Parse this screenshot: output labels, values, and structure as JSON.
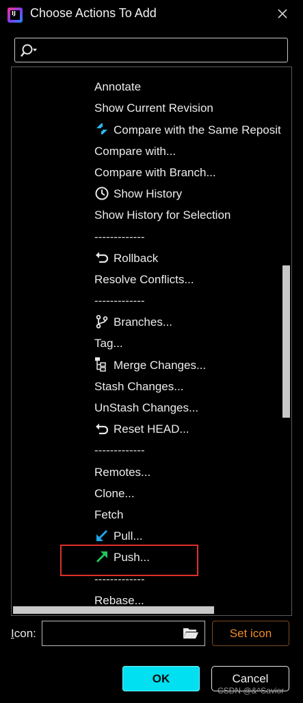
{
  "window": {
    "title": "Choose Actions To Add",
    "logo_text": "IJ"
  },
  "search": {
    "value": "",
    "placeholder": ""
  },
  "tree": {
    "items": [
      {
        "label": "-------------",
        "icon": null,
        "separator": true
      },
      {
        "label": "Annotate",
        "icon": null
      },
      {
        "label": "Show Current Revision",
        "icon": null
      },
      {
        "label": "Compare with the Same Reposit",
        "icon": "compare-icon"
      },
      {
        "label": "Compare with...",
        "icon": null
      },
      {
        "label": "Compare with Branch...",
        "icon": null
      },
      {
        "label": "Show History",
        "icon": "clock-icon"
      },
      {
        "label": "Show History for Selection",
        "icon": null
      },
      {
        "label": "-------------",
        "icon": null,
        "separator": true
      },
      {
        "label": "Rollback",
        "icon": "undo-icon"
      },
      {
        "label": "Resolve Conflicts...",
        "icon": null
      },
      {
        "label": "-------------",
        "icon": null,
        "separator": true
      },
      {
        "label": "Branches...",
        "icon": "branch-icon"
      },
      {
        "label": "Tag...",
        "icon": null
      },
      {
        "label": "Merge Changes...",
        "icon": "merge-icon"
      },
      {
        "label": "Stash Changes...",
        "icon": null
      },
      {
        "label": "UnStash Changes...",
        "icon": null
      },
      {
        "label": "Reset HEAD...",
        "icon": "undo-icon"
      },
      {
        "label": "-------------",
        "icon": null,
        "separator": true
      },
      {
        "label": "Remotes...",
        "icon": null
      },
      {
        "label": "Clone...",
        "icon": null
      },
      {
        "label": "Fetch",
        "icon": null
      },
      {
        "label": "Pull...",
        "icon": "pull-arrow-icon"
      },
      {
        "label": "Push...",
        "icon": "push-arrow-icon"
      },
      {
        "label": "-------------",
        "icon": null,
        "separator": true
      },
      {
        "label": "Rebase...",
        "icon": null
      }
    ]
  },
  "icon_row": {
    "label": "Icon:",
    "label_mnemonic": "I",
    "label_rest": "con:",
    "field_value": ""
  },
  "buttons": {
    "set_icon": "Set icon",
    "ok": "OK",
    "cancel": "Cancel"
  },
  "watermark": "CSDN @&^Savior",
  "colors": {
    "ok_bg": "#00e0f0",
    "set_icon_text": "#f08a24",
    "highlight": "#e0302a",
    "push_icon": "#22c55e",
    "pull_icon": "#1ea7e8",
    "compare_icon": "#2fb6f0"
  }
}
